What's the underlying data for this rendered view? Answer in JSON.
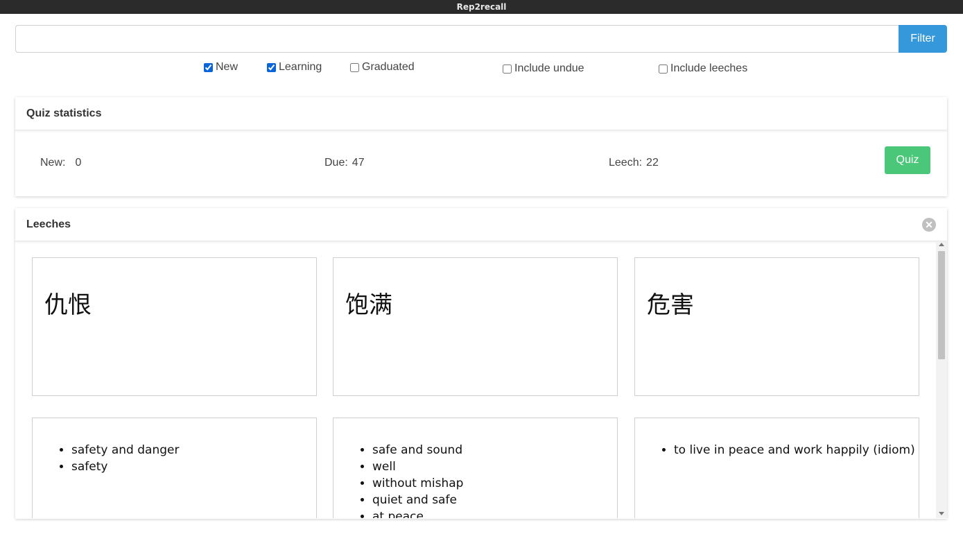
{
  "window": {
    "title": "Rep2recall"
  },
  "filter": {
    "value": "",
    "button_label": "Filter"
  },
  "checkboxes": [
    {
      "label": "New",
      "checked": true
    },
    {
      "label": "Learning",
      "checked": true
    },
    {
      "label": "Graduated",
      "checked": false
    },
    {
      "label": "Include undue",
      "checked": false
    },
    {
      "label": "Include leeches",
      "checked": false
    }
  ],
  "quiz_statistics": {
    "title": "Quiz statistics",
    "new_label": "New:",
    "new_value": "0",
    "due_label": "Due:",
    "due_value": "47",
    "leech_label": "Leech:",
    "leech_value": "22",
    "quiz_button": "Quiz"
  },
  "leeches": {
    "title": "Leeches",
    "words": [
      "仇恨",
      "饱满",
      "危害"
    ],
    "definitions": [
      [
        "safety and danger",
        "safety"
      ],
      [
        "safe and sound",
        "well",
        "without mishap",
        "quiet and safe",
        "at peace"
      ],
      [
        "to live in peace and work happily (idiom)"
      ]
    ]
  },
  "colors": {
    "accent": "#3498db",
    "quiz": "#4bc77a",
    "titlebar": "#2b2b2b"
  }
}
